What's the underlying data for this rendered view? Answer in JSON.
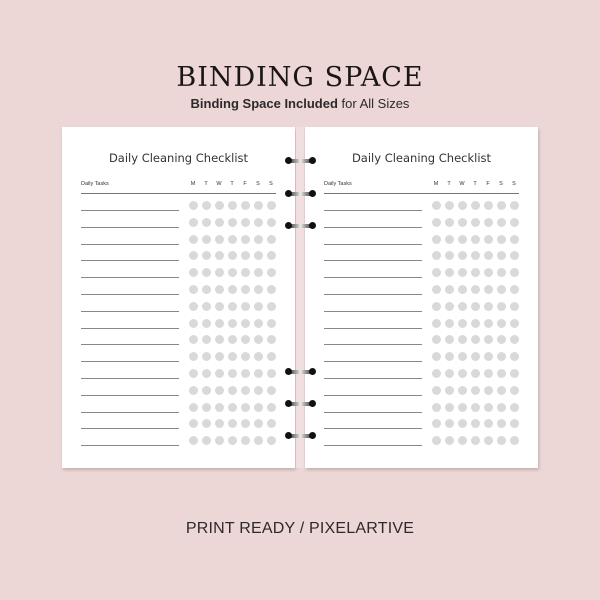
{
  "header": {
    "title": "BINDING SPACE",
    "subtitle_bold": "Binding Space Included",
    "subtitle_rest": " for All Sizes"
  },
  "pages": [
    {
      "title": "Daily Cleaning Checklist",
      "column_label": "Daily Tasks",
      "days": [
        "M",
        "T",
        "W",
        "T",
        "F",
        "S",
        "S"
      ],
      "row_count": 15
    },
    {
      "title": "Daily Cleaning Checklist",
      "column_label": "Daily Tasks",
      "days": [
        "M",
        "T",
        "W",
        "T",
        "F",
        "S",
        "S"
      ],
      "row_count": 15
    }
  ],
  "footer": {
    "text": "PRINT READY / PIXELARTIVE"
  },
  "colors": {
    "background": "#ecd6d6",
    "page": "#ffffff",
    "dot": "#d9d9d9"
  }
}
